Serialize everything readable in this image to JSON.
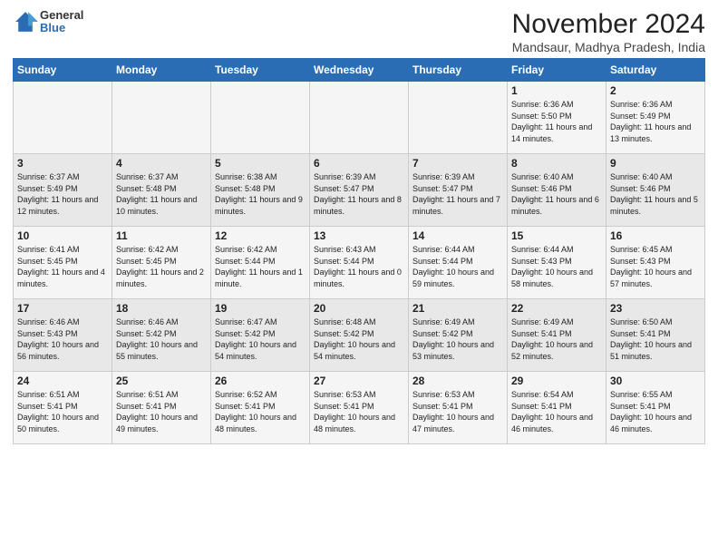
{
  "logo": {
    "general": "General",
    "blue": "Blue"
  },
  "header": {
    "title": "November 2024",
    "subtitle": "Mandsaur, Madhya Pradesh, India"
  },
  "days_of_week": [
    "Sunday",
    "Monday",
    "Tuesday",
    "Wednesday",
    "Thursday",
    "Friday",
    "Saturday"
  ],
  "weeks": [
    [
      {
        "num": "",
        "info": ""
      },
      {
        "num": "",
        "info": ""
      },
      {
        "num": "",
        "info": ""
      },
      {
        "num": "",
        "info": ""
      },
      {
        "num": "",
        "info": ""
      },
      {
        "num": "1",
        "info": "Sunrise: 6:36 AM\nSunset: 5:50 PM\nDaylight: 11 hours and 14 minutes."
      },
      {
        "num": "2",
        "info": "Sunrise: 6:36 AM\nSunset: 5:49 PM\nDaylight: 11 hours and 13 minutes."
      }
    ],
    [
      {
        "num": "3",
        "info": "Sunrise: 6:37 AM\nSunset: 5:49 PM\nDaylight: 11 hours and 12 minutes."
      },
      {
        "num": "4",
        "info": "Sunrise: 6:37 AM\nSunset: 5:48 PM\nDaylight: 11 hours and 10 minutes."
      },
      {
        "num": "5",
        "info": "Sunrise: 6:38 AM\nSunset: 5:48 PM\nDaylight: 11 hours and 9 minutes."
      },
      {
        "num": "6",
        "info": "Sunrise: 6:39 AM\nSunset: 5:47 PM\nDaylight: 11 hours and 8 minutes."
      },
      {
        "num": "7",
        "info": "Sunrise: 6:39 AM\nSunset: 5:47 PM\nDaylight: 11 hours and 7 minutes."
      },
      {
        "num": "8",
        "info": "Sunrise: 6:40 AM\nSunset: 5:46 PM\nDaylight: 11 hours and 6 minutes."
      },
      {
        "num": "9",
        "info": "Sunrise: 6:40 AM\nSunset: 5:46 PM\nDaylight: 11 hours and 5 minutes."
      }
    ],
    [
      {
        "num": "10",
        "info": "Sunrise: 6:41 AM\nSunset: 5:45 PM\nDaylight: 11 hours and 4 minutes."
      },
      {
        "num": "11",
        "info": "Sunrise: 6:42 AM\nSunset: 5:45 PM\nDaylight: 11 hours and 2 minutes."
      },
      {
        "num": "12",
        "info": "Sunrise: 6:42 AM\nSunset: 5:44 PM\nDaylight: 11 hours and 1 minute."
      },
      {
        "num": "13",
        "info": "Sunrise: 6:43 AM\nSunset: 5:44 PM\nDaylight: 11 hours and 0 minutes."
      },
      {
        "num": "14",
        "info": "Sunrise: 6:44 AM\nSunset: 5:44 PM\nDaylight: 10 hours and 59 minutes."
      },
      {
        "num": "15",
        "info": "Sunrise: 6:44 AM\nSunset: 5:43 PM\nDaylight: 10 hours and 58 minutes."
      },
      {
        "num": "16",
        "info": "Sunrise: 6:45 AM\nSunset: 5:43 PM\nDaylight: 10 hours and 57 minutes."
      }
    ],
    [
      {
        "num": "17",
        "info": "Sunrise: 6:46 AM\nSunset: 5:43 PM\nDaylight: 10 hours and 56 minutes."
      },
      {
        "num": "18",
        "info": "Sunrise: 6:46 AM\nSunset: 5:42 PM\nDaylight: 10 hours and 55 minutes."
      },
      {
        "num": "19",
        "info": "Sunrise: 6:47 AM\nSunset: 5:42 PM\nDaylight: 10 hours and 54 minutes."
      },
      {
        "num": "20",
        "info": "Sunrise: 6:48 AM\nSunset: 5:42 PM\nDaylight: 10 hours and 54 minutes."
      },
      {
        "num": "21",
        "info": "Sunrise: 6:49 AM\nSunset: 5:42 PM\nDaylight: 10 hours and 53 minutes."
      },
      {
        "num": "22",
        "info": "Sunrise: 6:49 AM\nSunset: 5:41 PM\nDaylight: 10 hours and 52 minutes."
      },
      {
        "num": "23",
        "info": "Sunrise: 6:50 AM\nSunset: 5:41 PM\nDaylight: 10 hours and 51 minutes."
      }
    ],
    [
      {
        "num": "24",
        "info": "Sunrise: 6:51 AM\nSunset: 5:41 PM\nDaylight: 10 hours and 50 minutes."
      },
      {
        "num": "25",
        "info": "Sunrise: 6:51 AM\nSunset: 5:41 PM\nDaylight: 10 hours and 49 minutes."
      },
      {
        "num": "26",
        "info": "Sunrise: 6:52 AM\nSunset: 5:41 PM\nDaylight: 10 hours and 48 minutes."
      },
      {
        "num": "27",
        "info": "Sunrise: 6:53 AM\nSunset: 5:41 PM\nDaylight: 10 hours and 48 minutes."
      },
      {
        "num": "28",
        "info": "Sunrise: 6:53 AM\nSunset: 5:41 PM\nDaylight: 10 hours and 47 minutes."
      },
      {
        "num": "29",
        "info": "Sunrise: 6:54 AM\nSunset: 5:41 PM\nDaylight: 10 hours and 46 minutes."
      },
      {
        "num": "30",
        "info": "Sunrise: 6:55 AM\nSunset: 5:41 PM\nDaylight: 10 hours and 46 minutes."
      }
    ]
  ]
}
